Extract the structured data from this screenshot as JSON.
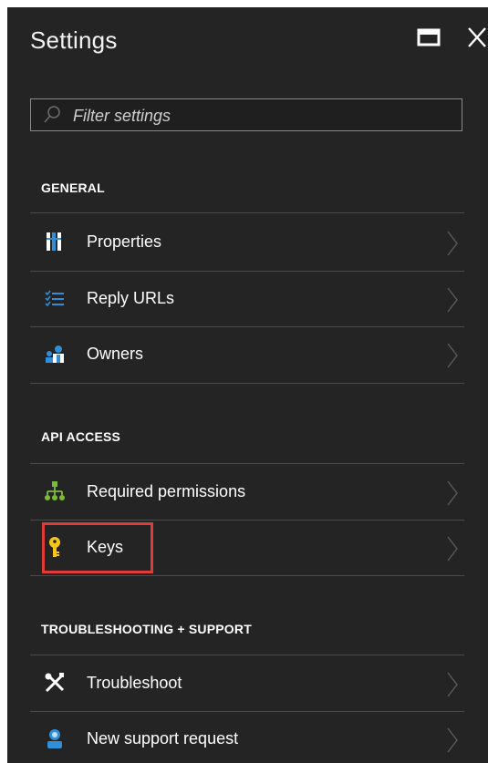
{
  "header": {
    "title": "Settings"
  },
  "filter": {
    "placeholder": "Filter settings",
    "value": ""
  },
  "sections": {
    "general": {
      "label": "GENERAL",
      "items": [
        {
          "label": "Properties",
          "icon": "properties-icon"
        },
        {
          "label": "Reply URLs",
          "icon": "list-icon"
        },
        {
          "label": "Owners",
          "icon": "owners-icon"
        }
      ]
    },
    "api_access": {
      "label": "API ACCESS",
      "items": [
        {
          "label": "Required permissions",
          "icon": "permissions-icon"
        },
        {
          "label": "Keys",
          "icon": "key-icon"
        }
      ]
    },
    "support": {
      "label": "TROUBLESHOOTING + SUPPORT",
      "items": [
        {
          "label": "Troubleshoot",
          "icon": "tools-icon"
        },
        {
          "label": "New support request",
          "icon": "support-person-icon"
        }
      ]
    }
  },
  "colors": {
    "background": "#242424",
    "divider": "#4a4a4a",
    "highlight": "#e03b3b",
    "key": "#f5c518",
    "permissions": "#7cbb3a",
    "accent_blue": "#2f8fd8"
  }
}
